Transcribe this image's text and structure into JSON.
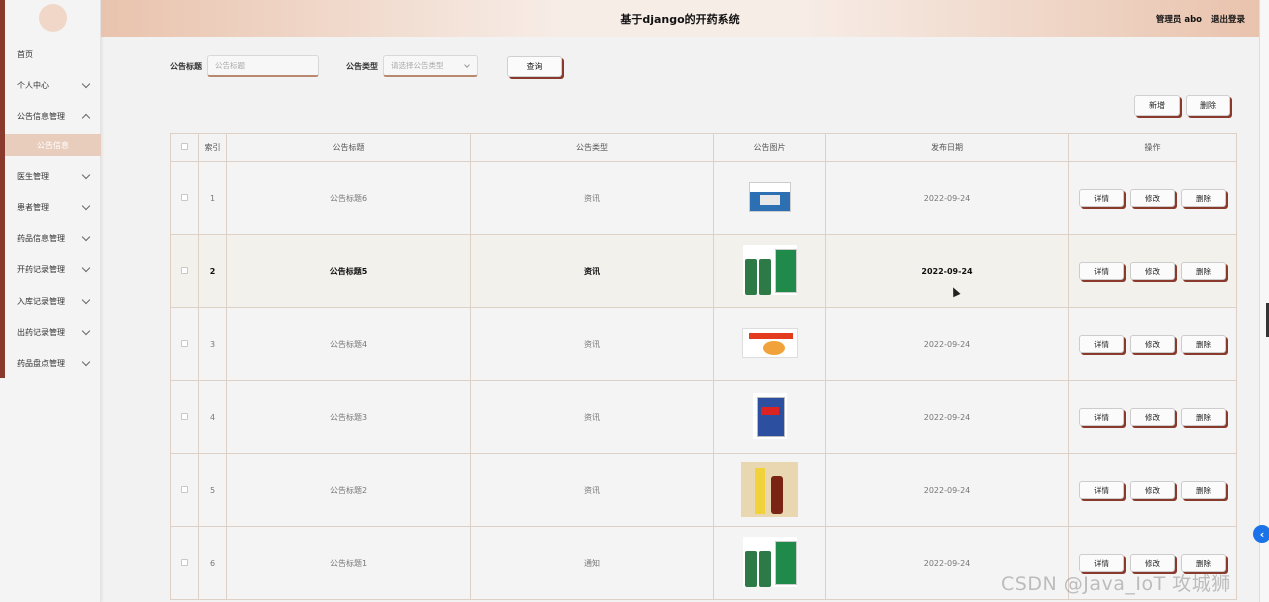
{
  "header": {
    "title": "基于django的开药系统",
    "user_role": "管理员 abo",
    "logout": "退出登录"
  },
  "sidebar": {
    "items": [
      {
        "label": "首页",
        "expandable": false
      },
      {
        "label": "个人中心",
        "expandable": true
      },
      {
        "label": "公告信息管理",
        "expandable": true,
        "expanded": true
      },
      {
        "label": "医生管理",
        "expandable": true
      },
      {
        "label": "患者管理",
        "expandable": true
      },
      {
        "label": "药品信息管理",
        "expandable": true
      },
      {
        "label": "开药记录管理",
        "expandable": true
      },
      {
        "label": "入库记录管理",
        "expandable": true
      },
      {
        "label": "出药记录管理",
        "expandable": true
      },
      {
        "label": "药品盘点管理",
        "expandable": true
      }
    ],
    "active_sub": "公告信息"
  },
  "search": {
    "title_label": "公告标题",
    "title_placeholder": "公告标题",
    "type_label": "公告类型",
    "type_placeholder": "请选择公告类型",
    "query_button": "查询"
  },
  "actions": {
    "add": "新增",
    "delete": "删除"
  },
  "table": {
    "headers": [
      "",
      "索引",
      "公告标题",
      "公告类型",
      "公告图片",
      "发布日期",
      "操作"
    ],
    "rows": [
      {
        "index": "1",
        "title": "公告标题6",
        "type": "资讯",
        "image": "medicine-box",
        "date": "2022-09-24"
      },
      {
        "index": "2",
        "title": "公告标题5",
        "type": "资讯",
        "image": "medicine-bottles",
        "date": "2022-09-24"
      },
      {
        "index": "3",
        "title": "公告标题4",
        "type": "资讯",
        "image": "medicine-pack",
        "date": "2022-09-24"
      },
      {
        "index": "4",
        "title": "公告标题3",
        "type": "资讯",
        "image": "medicine-box-blue",
        "date": "2022-09-24"
      },
      {
        "index": "5",
        "title": "公告标题2",
        "type": "资讯",
        "image": "syrup-bottle",
        "date": "2022-09-24"
      },
      {
        "index": "6",
        "title": "公告标题1",
        "type": "通知",
        "image": "medicine-bottles",
        "date": "2022-09-24"
      }
    ],
    "row_ops": [
      "详情",
      "修改",
      "删除"
    ]
  },
  "watermark": "CSDN @Java_IoT 攻城狮",
  "colors": {
    "accent": "#8a3a2c",
    "header_gradient": "#e9c3ad",
    "submenu": "#e8cdbd"
  }
}
